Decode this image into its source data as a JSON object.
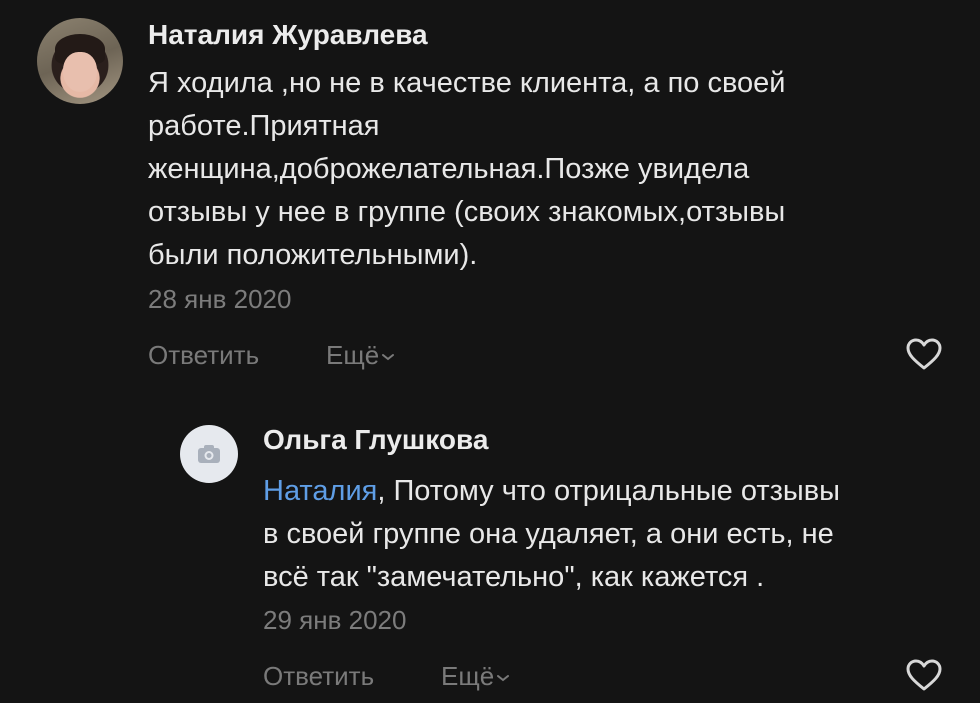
{
  "comments": [
    {
      "author": "Наталия Журавлева",
      "avatar_icon": "user-photo",
      "text_lines": [
        "Я ходила ,но не в качестве клиента, а по своей",
        "работе.Приятная",
        "женщина,доброжелательная.Позже увидела",
        "отзывы у нее в группе (своих знакомых,отзывы",
        "были положительными)."
      ],
      "date": "28 янв 2020",
      "reply_label": "Ответить",
      "more_label": "Ещё",
      "like_icon": "heart-icon"
    },
    {
      "author": "Ольга Глушкова",
      "avatar_icon": "camera-icon",
      "mention": "Наталия",
      "text_lines": [
        ", Потому что отрицальные отзывы",
        "в своей группе она удаляет, а они есть, не",
        "всё так \"замечательно\", как кажется ."
      ],
      "date": "29 янв 2020",
      "reply_label": "Ответить",
      "more_label": "Ещё",
      "like_icon": "heart-icon"
    }
  ],
  "colors": {
    "background": "#141414",
    "text": "#e8e8e8",
    "muted": "#7a7a7a",
    "mention": "#5f9ee6"
  }
}
